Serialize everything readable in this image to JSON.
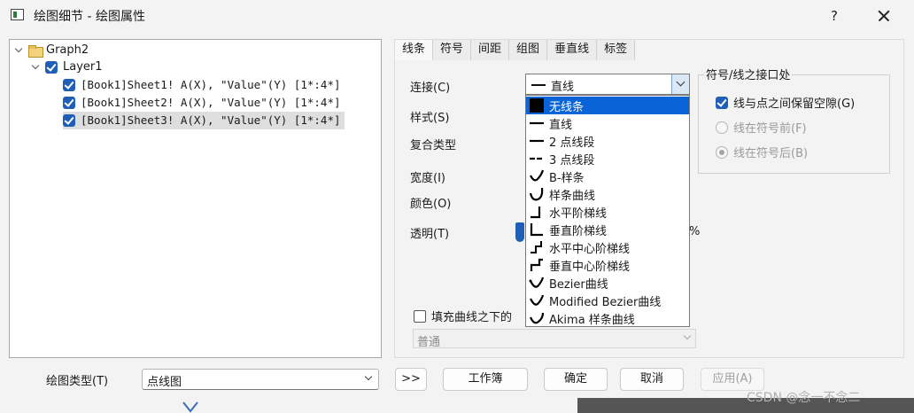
{
  "window": {
    "title": "绘图细节 - 绘图属性",
    "help_label": "?"
  },
  "tree": {
    "root": "Graph2",
    "layer": "Layer1",
    "items": [
      "[Book1]Sheet1! A(X), \"Value\"(Y) [1*:4*]",
      "[Book1]Sheet2! A(X), \"Value\"(Y) [1*:4*]",
      "[Book1]Sheet3! A(X), \"Value\"(Y) [1*:4*]"
    ]
  },
  "tabs": [
    "线条",
    "符号",
    "间距",
    "组图",
    "垂直线",
    "标签"
  ],
  "line_tab": {
    "connect_label": "连接(C)",
    "connect_value": "直线",
    "style_label": "样式(S)",
    "compound_label": "复合类型",
    "width_label": "宽度(I)",
    "color_label": "颜色(O)",
    "transparency_label": "透明(T)",
    "transparency_unit": "%",
    "fill_label": "填充曲线之下的",
    "fill_mode_value": "普通"
  },
  "interface_group": {
    "title": "符号/线之接口处",
    "gap_label": "线与点之间保留空隙(G)",
    "before_label": "线在符号前(F)",
    "after_label": "线在符号后(B)"
  },
  "dropdown": {
    "items": [
      "无线条",
      "直线",
      "2 点线段",
      "3 点线段",
      "B-样条",
      "样条曲线",
      "水平阶梯线",
      "垂直阶梯线",
      "水平中心阶梯线",
      "垂直中心阶梯线",
      "Bezier曲线",
      "Modified Bezier曲线",
      "Akima 样条曲线"
    ],
    "selected_index": 0
  },
  "bottom": {
    "plot_type_label": "绘图类型(T)",
    "plot_type_value": "点线图",
    "more_label": ">>",
    "workbook_label": "工作簿",
    "ok_label": "确定",
    "cancel_label": "取消",
    "apply_label": "应用(A)"
  },
  "watermark": "CSDN @念一不念二",
  "colors": {
    "accent": "#0a64d8",
    "checkbox": "#1f5fb5"
  }
}
